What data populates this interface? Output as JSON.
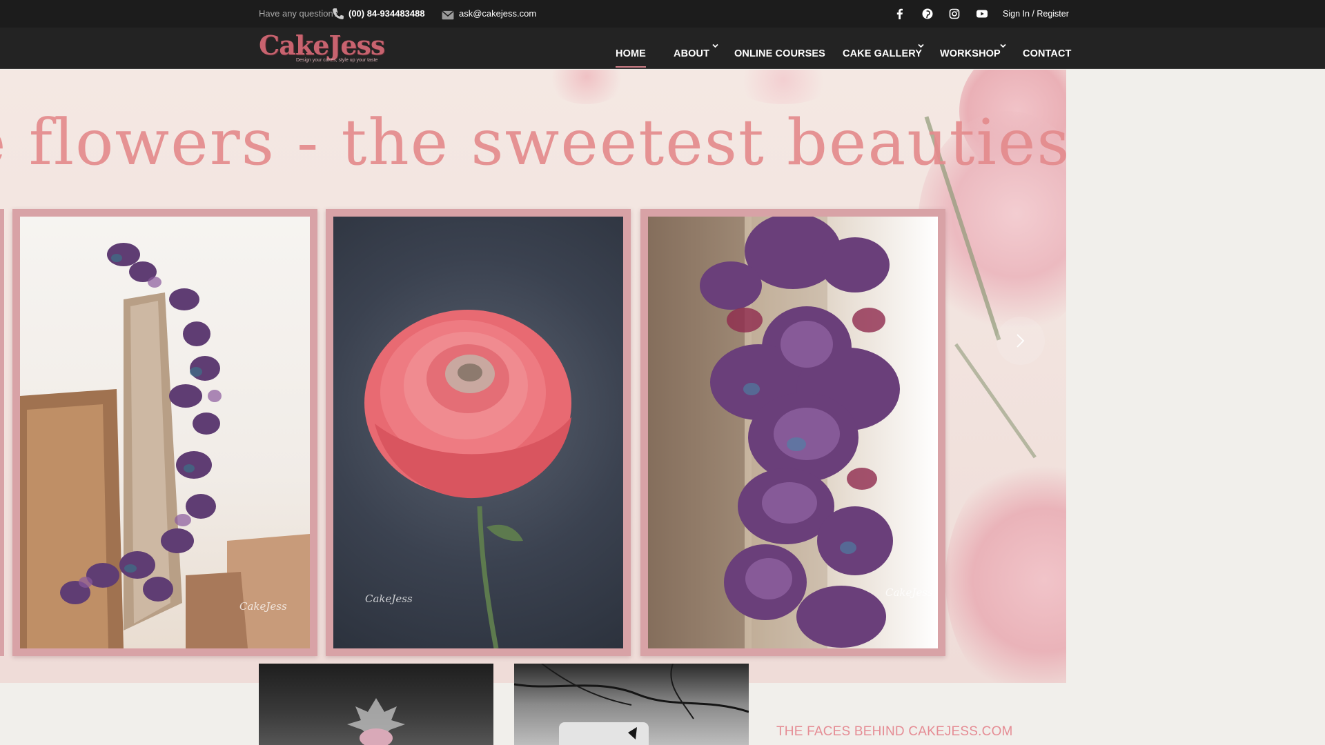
{
  "topbar": {
    "question_label": "Have any question?",
    "phone": "(00) 84-934483488",
    "email": "ask@cakejess.com",
    "social_icons": [
      "facebook-icon",
      "pinterest-icon",
      "instagram-icon",
      "youtube-icon"
    ],
    "auth_link": "Sign In / Register"
  },
  "brand": {
    "logo_text": "CakeJess",
    "tagline": "Design your cakes, style up your taste"
  },
  "nav": {
    "home": "HOME",
    "about": "ABOUT",
    "online_courses": "ONLINE COURSES",
    "cake_gallery": "CAKE GALLERY",
    "workshop": "WORKSHOP",
    "contact": "CONTACT",
    "active": "HOME"
  },
  "hero": {
    "title": "e flowers - the sweetest beauties",
    "watermarks": [
      "CakeJess",
      "CakeJess",
      "CakeJess"
    ],
    "next_icon": "chevron-right-icon"
  },
  "about_section": {
    "heading": "THE FACES BEHIND CAKEJESS.COM"
  },
  "colors": {
    "topbar_bg": "#1c1c1c",
    "nav_bg": "#232323",
    "brand_pink": "#c8636f",
    "title_pink": "#e48b8d",
    "frame_pink": "#d8a2a6",
    "heading_pink": "#e58c94",
    "section_bg": "#f1efeb"
  }
}
